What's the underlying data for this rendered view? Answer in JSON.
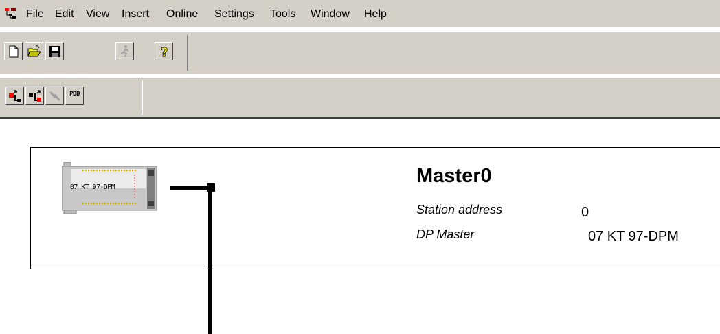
{
  "menu": {
    "items": [
      "File",
      "Edit",
      "View",
      "Insert",
      "Online",
      "Settings",
      "Tools",
      "Window",
      "Help"
    ]
  },
  "toolbar1": {
    "buttons": [
      "new-icon",
      "open-icon",
      "save-icon",
      "run-icon",
      "help-icon"
    ]
  },
  "toolbar2": {
    "buttons": [
      "download-icon",
      "upload-icon",
      "connect-icon",
      "pdd-icon"
    ],
    "pdd_label": "PDD"
  },
  "station": {
    "device_label": "07 KT 97-DPM",
    "title": "Master0",
    "props": [
      {
        "label": "Station address",
        "value": "0"
      },
      {
        "label": "DP Master",
        "value": "07 KT 97-DPM"
      }
    ]
  },
  "colors": {
    "chrome": "#d4d0c8",
    "accent_red": "#ff0000",
    "bus": "#000000"
  }
}
